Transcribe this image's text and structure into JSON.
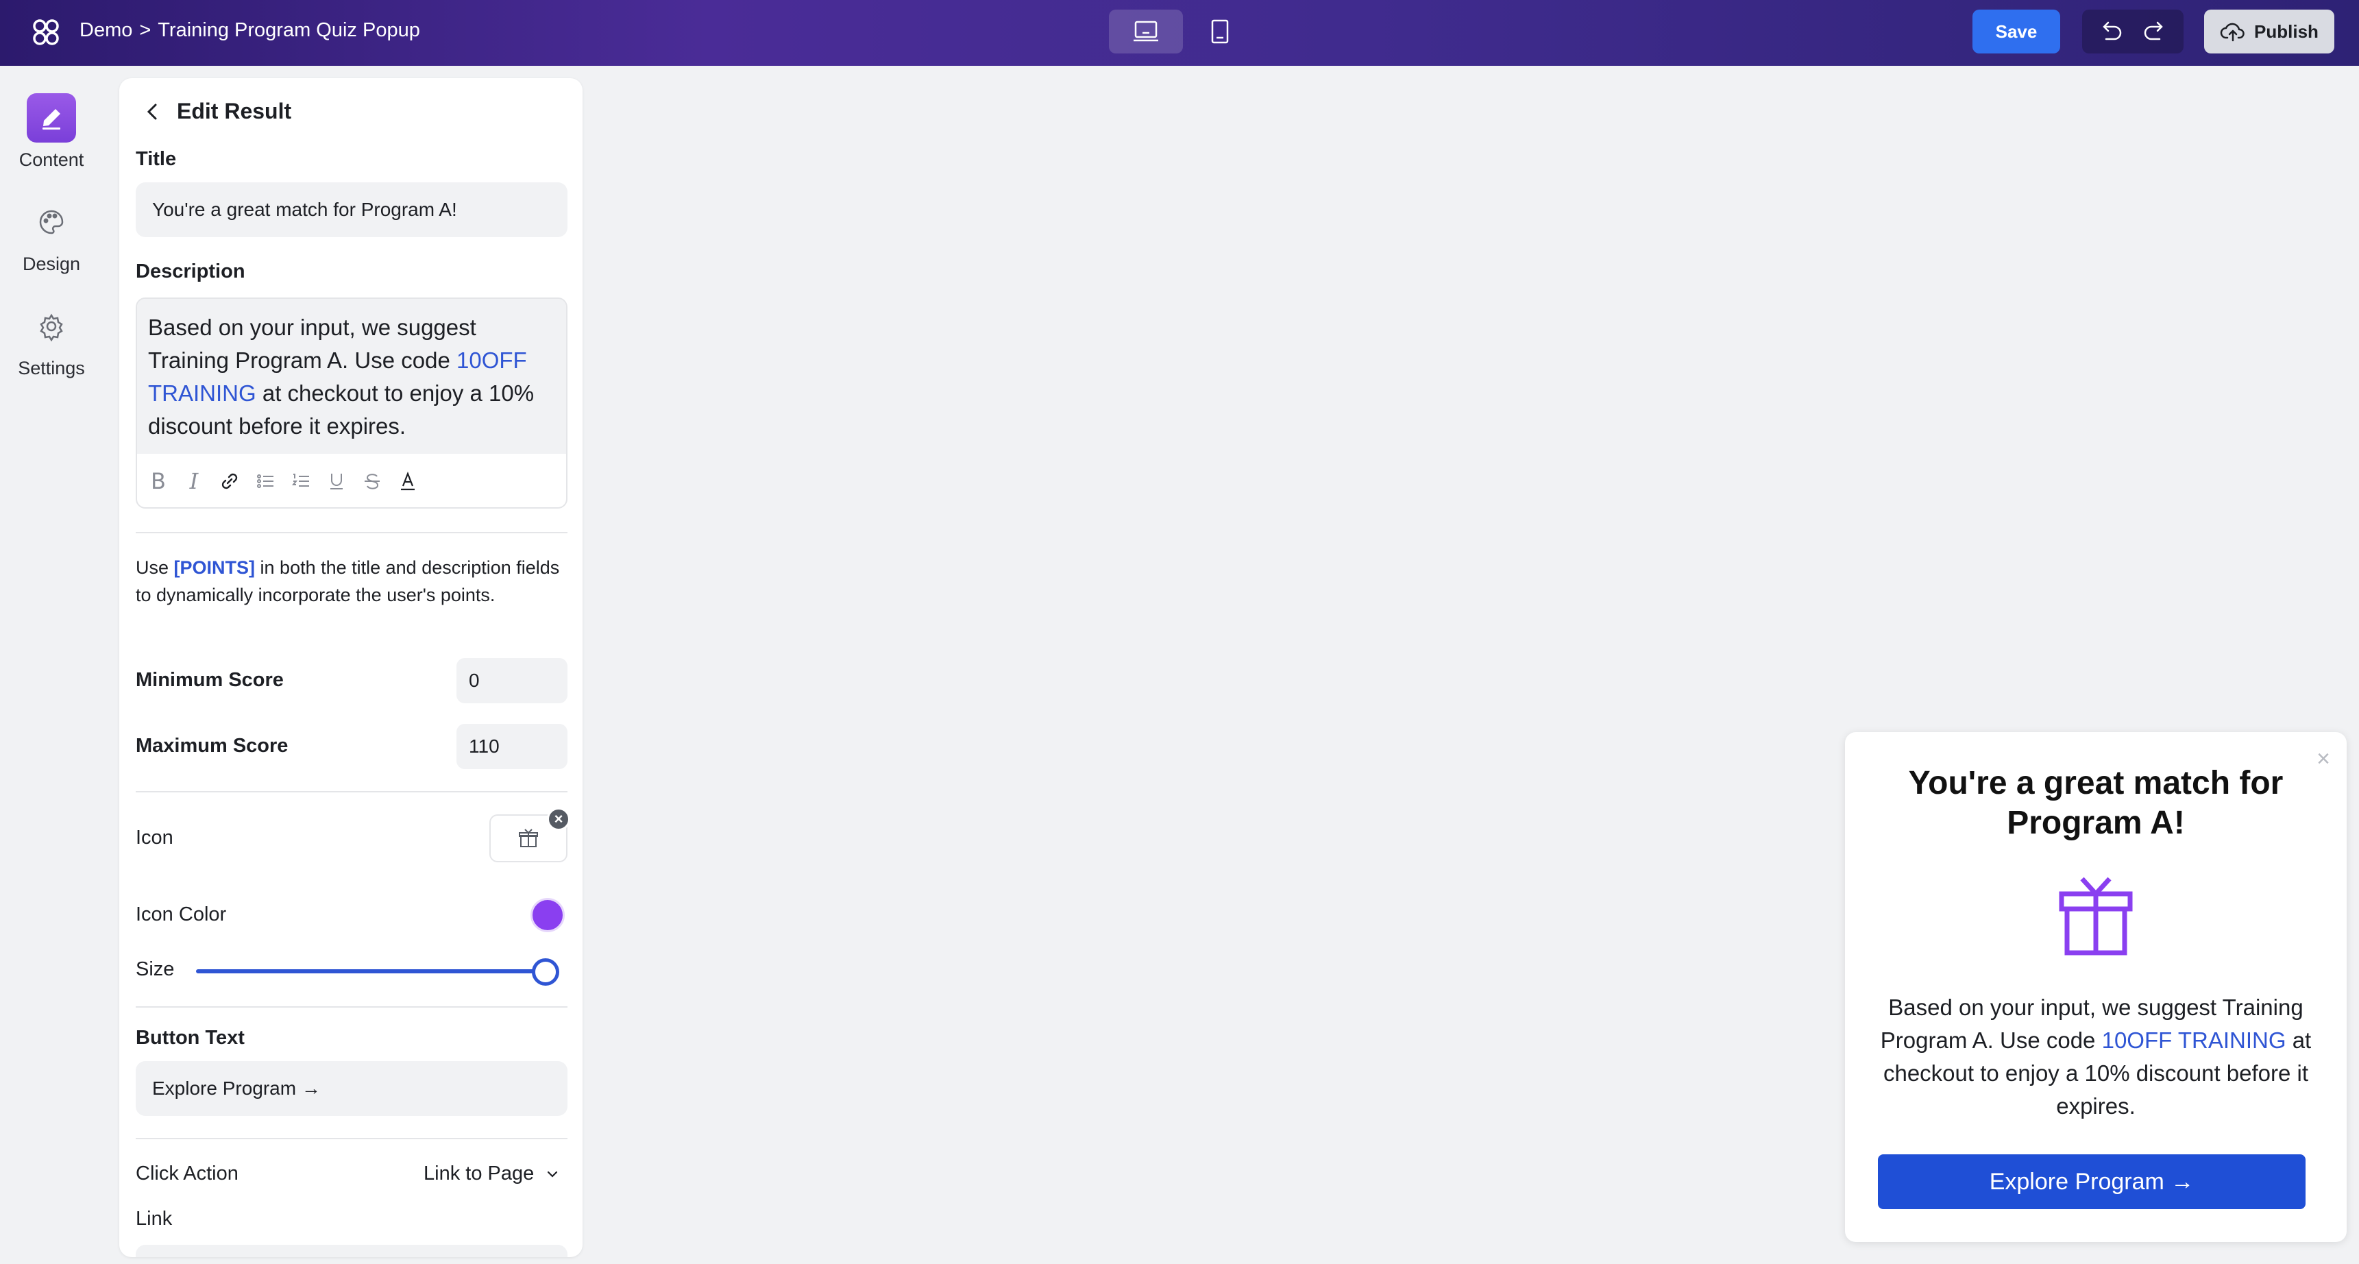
{
  "header": {
    "crumb_root": "Demo",
    "crumb_sep": ">",
    "crumb_current": "Training Program Quiz Popup",
    "save_label": "Save",
    "publish_label": "Publish"
  },
  "rail": {
    "items": [
      {
        "label": "Content",
        "icon": "pencil-icon",
        "active": true
      },
      {
        "label": "Design",
        "icon": "palette-icon",
        "active": false
      },
      {
        "label": "Settings",
        "icon": "gear-icon",
        "active": false
      }
    ]
  },
  "panel": {
    "heading": "Edit Result",
    "title_label": "Title",
    "title_value": "You're a great match for Program A!",
    "description_label": "Description",
    "description": {
      "before": "Based on your input, we suggest Training Program A. Use code ",
      "code": "10OFF TRAINING",
      "after": " at checkout to enjoy a 10% discount before it expires."
    },
    "help": {
      "before": "Use ",
      "token": "[POINTS]",
      "after": " in both the title and description fields to dynamically incorporate the user's points."
    },
    "min_score_label": "Minimum Score",
    "min_score": "0",
    "max_score_label": "Maximum Score",
    "max_score": "110",
    "icon_label": "Icon",
    "icon_name": "gift-icon",
    "icon_color_label": "Icon Color",
    "icon_color": "#8a3ff0",
    "size_label": "Size",
    "size_value": 1.0,
    "button_text_label": "Button Text",
    "button_text": "Explore Program  →",
    "click_action_label": "Click Action",
    "click_action": "Link to Page",
    "link_label": "Link"
  },
  "popup": {
    "title": "You're a great match for Program A!",
    "desc_before": "Based on your input, we suggest Training Program A. Use code ",
    "desc_code": "10OFF TRAINING",
    "desc_after": " at checkout to enjoy a 10% discount before it expires.",
    "button": "Explore Program  →",
    "close": "×"
  },
  "colors": {
    "accent": "#2f55d4",
    "save": "#2f6fef",
    "popup_button": "#1f4fd6",
    "icon": "#8a3ff0"
  }
}
